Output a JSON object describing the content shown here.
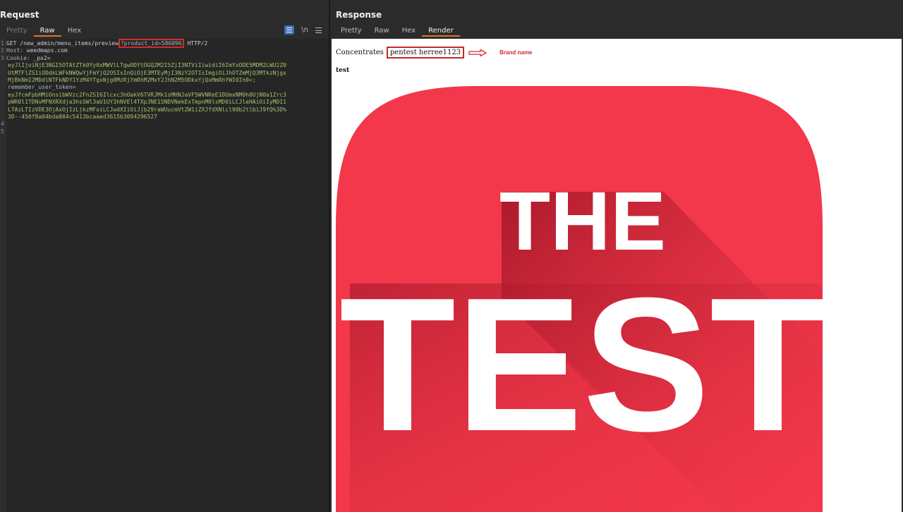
{
  "request": {
    "title": "Request",
    "tabs": [
      {
        "label": "Pretty",
        "state": "dim"
      },
      {
        "label": "Raw",
        "state": "active"
      },
      {
        "label": "Hex",
        "state": "normal"
      }
    ],
    "tools": {
      "newline_label": "\\n"
    },
    "lines": {
      "l1_prefix": "GET /new_admin/menu_items/preview",
      "l1_param": "?product_id=586096",
      "l1_suffix": " HTTP/2",
      "l2_key": "Host:",
      "l2_val": " weedmaps.com",
      "l3_key": "Cookie:",
      "l3_val": " _px2=",
      "cookie_lines": [
        "eyJlIjoiNjE3NGI5OTAtZTk0Yy0xMWVlLTgwODYtOGQ2M2I5ZjI3NTViIiwidiI6ImYxODE5MDM2LWU2Z0",
        "UtMTFlZS1iODdkLWFkNWQwYjFmYjQ2OSIsInQiOjE3MTEyMjI3NzY2OTIsImgiOiJhOTZmMjQ3MTkzNjgx",
        "MjBkNmI2MDdlNTFkNDY1YzM4YTgxNjg0MzRjYmRhM2MxY2JhN2M5ODkxYjQxMmRhYWI0In0=;"
      ],
      "token_key": "remember_user_token=",
      "token_lines": [
        "eyJfcmFpbHMiOnsibWVzc2FnZSI6Ilcxc3hOakV6TVRJMk1sMHNJaVF5WVNReE1DUmxNM0h0UjN0a1Zrc3",
        "pWR0l1TDNvMFNXRXdja3hsSWl3aU1UY3hNVEl4TXpJNE15NDVNekExTmpnM0lsMD0iLCJleHAiOiIyMDI1",
        "LTAzLTIzVDE3OjAxOjIzLjkzMFoiLCJwdXIiOiJjb29raWUucmVtZW1iZXJfdXNlcl90b2tlbiJ9fQ%3D%",
        "3D--450f8a04bda804c5413bcaaed3615b3094296527"
      ],
      "numbers": [
        "1",
        "2",
        "3",
        "4",
        "5"
      ]
    }
  },
  "response": {
    "title": "Response",
    "tabs": [
      {
        "label": "Pretty",
        "state": "normal"
      },
      {
        "label": "Raw",
        "state": "normal"
      },
      {
        "label": "Hex",
        "state": "normal"
      },
      {
        "label": "Render",
        "state": "active"
      }
    ],
    "render": {
      "category_label": "Concentrates",
      "brand_value": "pentest herree1123",
      "annotation": "Brand name",
      "product_label": "test",
      "logo_line1": "THE",
      "logo_line2": "TEST",
      "logo_color": "#f2384a",
      "logo_shadow": "#a3182a"
    }
  },
  "colors": {
    "accent_tab": "#e8702a",
    "highlight_box": "#d32a2a",
    "wrap_button": "#3d6eb5"
  },
  "icons": [
    "wrap-lines-icon",
    "newline-icon",
    "menu-icon",
    "right-arrow-icon"
  ]
}
